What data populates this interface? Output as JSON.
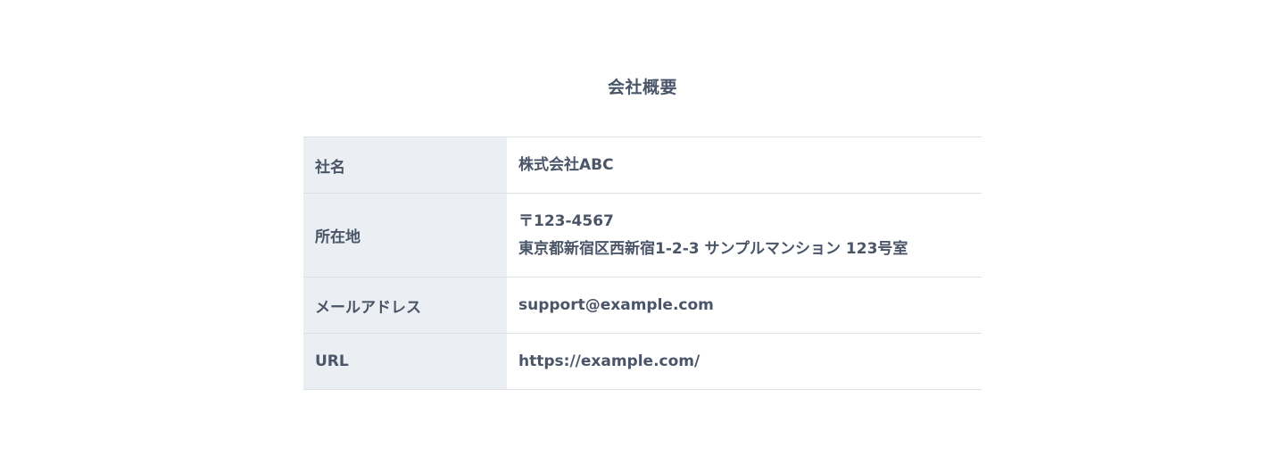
{
  "section": {
    "title": "会社概要"
  },
  "company_table": {
    "rows": [
      {
        "label": "社名",
        "value": "株式会社ABC"
      },
      {
        "label": "所在地",
        "value_lines": [
          "〒123-4567",
          "東京都新宿区西新宿1-2-3 サンプルマンション 123号室"
        ]
      },
      {
        "label": "メールアドレス",
        "value": "support@example.com"
      },
      {
        "label": "URL",
        "value": "https://example.com/"
      }
    ]
  }
}
